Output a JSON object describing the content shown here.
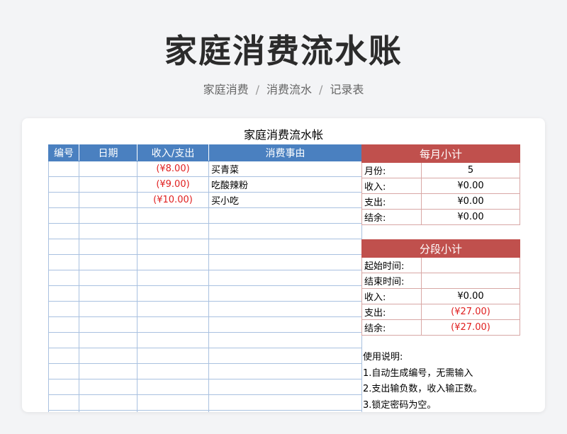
{
  "header": {
    "title": "家庭消费流水账",
    "breadcrumb": [
      "家庭消费",
      "消费流水",
      "记录表"
    ],
    "separator": "/"
  },
  "sheet": {
    "title": "家庭消费流水帐",
    "columns": [
      "编号",
      "日期",
      "收入/支出",
      "消费事由"
    ],
    "rows": [
      {
        "id": "",
        "date": "",
        "amount": "(¥8.00)",
        "reason": "买青菜"
      },
      {
        "id": "",
        "date": "",
        "amount": "(¥9.00)",
        "reason": "吃酸辣粉"
      },
      {
        "id": "",
        "date": "",
        "amount": "(¥10.00)",
        "reason": "买小吃"
      },
      {
        "id": "",
        "date": "",
        "amount": "",
        "reason": ""
      },
      {
        "id": "",
        "date": "",
        "amount": "",
        "reason": ""
      },
      {
        "id": "",
        "date": "",
        "amount": "",
        "reason": ""
      },
      {
        "id": "",
        "date": "",
        "amount": "",
        "reason": ""
      },
      {
        "id": "",
        "date": "",
        "amount": "",
        "reason": ""
      },
      {
        "id": "",
        "date": "",
        "amount": "",
        "reason": ""
      },
      {
        "id": "",
        "date": "",
        "amount": "",
        "reason": ""
      },
      {
        "id": "",
        "date": "",
        "amount": "",
        "reason": ""
      },
      {
        "id": "",
        "date": "",
        "amount": "",
        "reason": ""
      },
      {
        "id": "",
        "date": "",
        "amount": "",
        "reason": ""
      },
      {
        "id": "",
        "date": "",
        "amount": "",
        "reason": ""
      },
      {
        "id": "",
        "date": "",
        "amount": "",
        "reason": ""
      },
      {
        "id": "",
        "date": "",
        "amount": "",
        "reason": ""
      },
      {
        "id": "",
        "date": "",
        "amount": "",
        "reason": ""
      }
    ],
    "monthly": {
      "title": "每月小计",
      "rows": [
        {
          "label": "月份:",
          "value": "5"
        },
        {
          "label": "收入:",
          "value": "¥0.00"
        },
        {
          "label": "支出:",
          "value": "¥0.00"
        },
        {
          "label": "结余:",
          "value": "¥0.00"
        }
      ]
    },
    "segment": {
      "title": "分段小计",
      "rows": [
        {
          "label": "起始时间:",
          "value": ""
        },
        {
          "label": "结束时间:",
          "value": ""
        },
        {
          "label": "收入:",
          "value": "¥0.00"
        },
        {
          "label": "支出:",
          "value": "(¥27.00)"
        },
        {
          "label": "结余:",
          "value": "(¥27.00)"
        }
      ]
    },
    "instructions": [
      "使用说明:",
      "1.自动生成编号，无需输入",
      "2.支出输负数，收入输正数。",
      "3.锁定密码为空。"
    ]
  },
  "colors": {
    "header_blue": "#4a80c0",
    "header_red": "#c0504d",
    "negative": "#e02020"
  }
}
